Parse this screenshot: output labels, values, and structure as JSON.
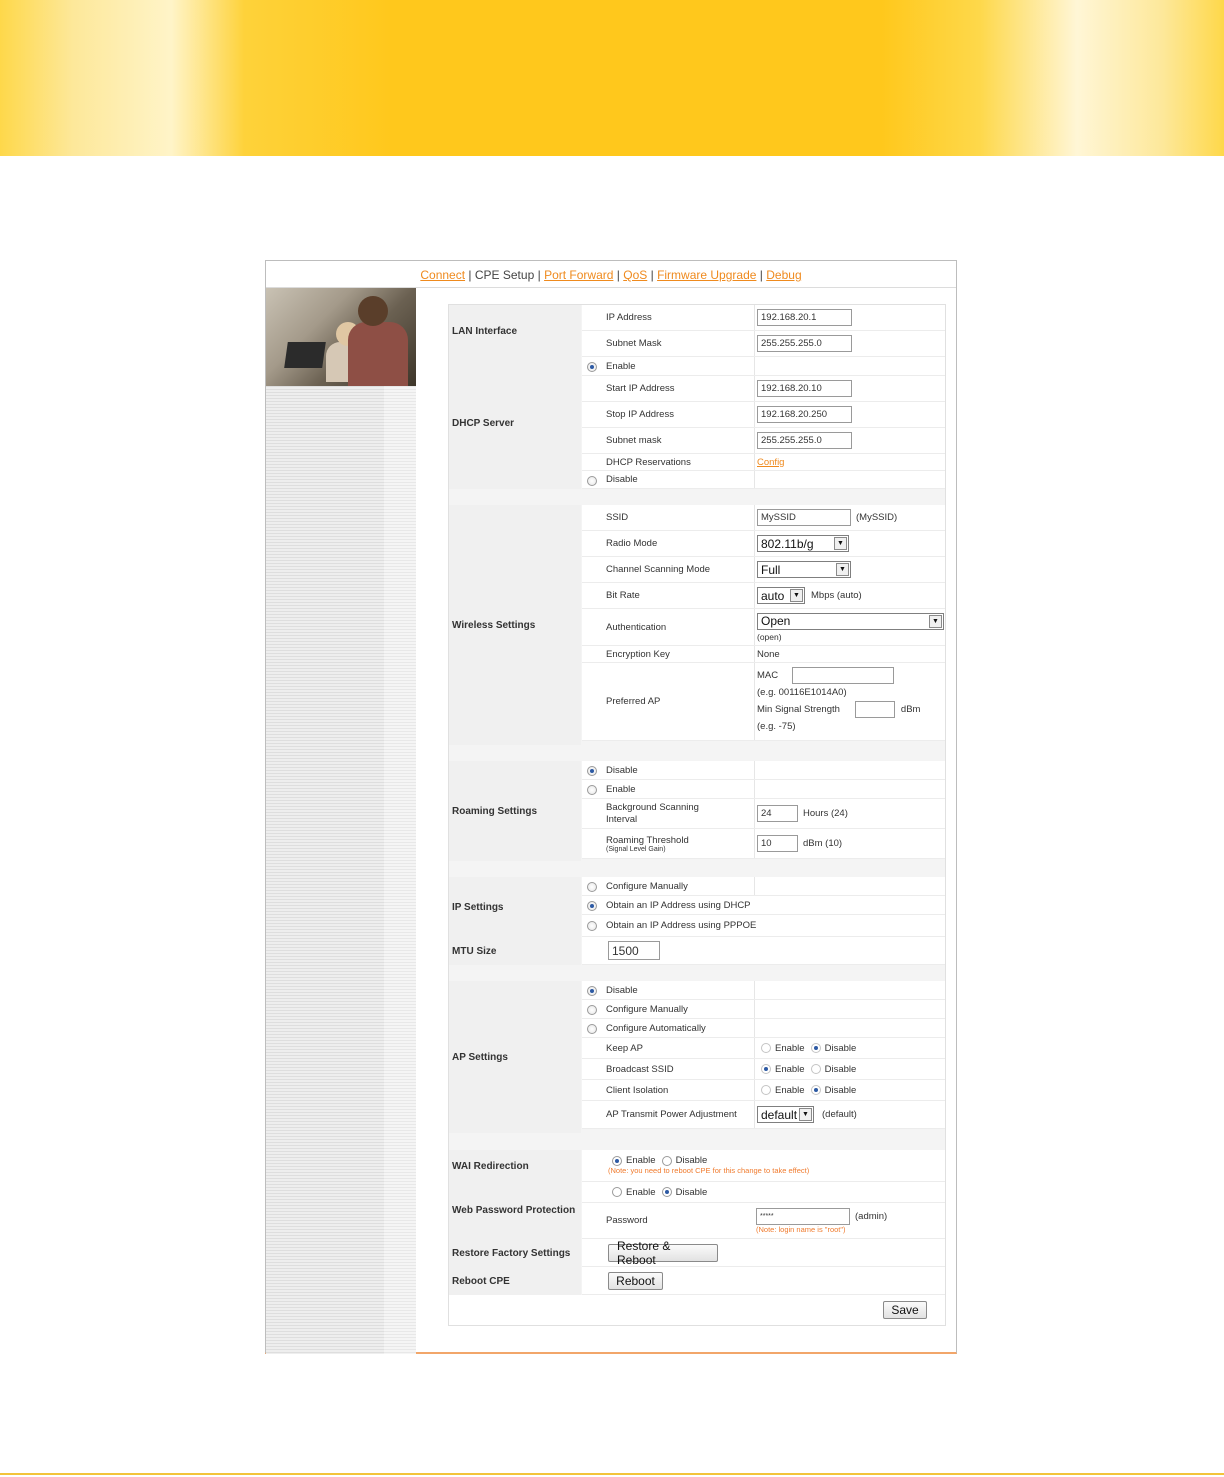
{
  "nav": {
    "connect": "Connect",
    "cpe_setup": "CPE Setup",
    "port_forward": "Port Forward",
    "qos": "QoS",
    "firmware_upgrade": "Firmware Upgrade",
    "debug": "Debug",
    "sep": "|"
  },
  "lan": {
    "section": "LAN Interface",
    "ip_label": "IP Address",
    "ip_value": "192.168.20.1",
    "mask_label": "Subnet Mask",
    "mask_value": "255.255.255.0"
  },
  "dhcp": {
    "section": "DHCP Server",
    "enable": "Enable",
    "start_label": "Start IP Address",
    "start_value": "192.168.20.10",
    "stop_label": "Stop IP Address",
    "stop_value": "192.168.20.250",
    "mask_label": "Subnet mask",
    "mask_value": "255.255.255.0",
    "reservations_label": "DHCP Reservations",
    "reservations_link": "Config",
    "disable": "Disable"
  },
  "wireless": {
    "section": "Wireless Settings",
    "ssid_label": "SSID",
    "ssid_value": "MySSID",
    "ssid_default": "(MySSID)",
    "radio_label": "Radio Mode",
    "radio_value": "802.11b/g",
    "scan_label": "Channel Scanning Mode",
    "scan_value": "Full",
    "bitrate_label": "Bit Rate",
    "bitrate_value": "auto",
    "bitrate_unit": "Mbps (auto)",
    "auth_label": "Authentication",
    "auth_value": "Open",
    "auth_note": "(open)",
    "enc_label": "Encryption Key",
    "enc_value": "None",
    "pref_label": "Preferred AP",
    "mac_label": "MAC",
    "mac_example": "(e.g. 00116E1014A0)",
    "min_signal_label": "Min Signal Strength",
    "dbm": "dBm",
    "min_signal_example": "(e.g. -75)"
  },
  "roaming": {
    "section": "Roaming Settings",
    "disable": "Disable",
    "enable": "Enable",
    "bg_label": "Background Scanning Interval",
    "bg_value": "24",
    "bg_unit": "Hours (24)",
    "thr_label": "Roaming Threshold",
    "thr_sub": "(Signal Level Gain)",
    "thr_value": "10",
    "thr_unit": "dBm (10)"
  },
  "ip": {
    "section": "IP Settings",
    "manual": "Configure Manually",
    "dhcp": "Obtain an IP Address using DHCP",
    "pppoe": "Obtain an IP Address using PPPOE"
  },
  "mtu": {
    "section": "MTU Size",
    "value": "1500"
  },
  "ap": {
    "section": "AP Settings",
    "disable": "Disable",
    "manual": "Configure Manually",
    "auto": "Configure Automatically",
    "keep_label": "Keep AP",
    "broadcast_label": "Broadcast SSID",
    "isolation_label": "Client Isolation",
    "enable": "Enable",
    "disable_opt": "Disable",
    "power_label": "AP Transmit Power Adjustment",
    "power_value": "default",
    "power_default": "(default)"
  },
  "wai": {
    "section": "WAI Redirection",
    "enable": "Enable",
    "disable": "Disable",
    "note": "(Note: you need to reboot CPE for this change to take effect)"
  },
  "webpw": {
    "section": "Web Password Protection",
    "enable": "Enable",
    "disable": "Disable",
    "pw_label": "Password",
    "pw_value": "*****",
    "pw_default": "(admin)",
    "note": "(Note: login name is \"root\")"
  },
  "restore": {
    "section": "Restore Factory Settings",
    "button": "Restore & Reboot"
  },
  "reboot": {
    "section": "Reboot CPE",
    "button": "Reboot"
  },
  "save": "Save",
  "colors": {
    "banner": "#ffc81c",
    "link": "#ef8a1e",
    "note": "#f07b2e",
    "radio_dot": "#2d5aa4"
  }
}
